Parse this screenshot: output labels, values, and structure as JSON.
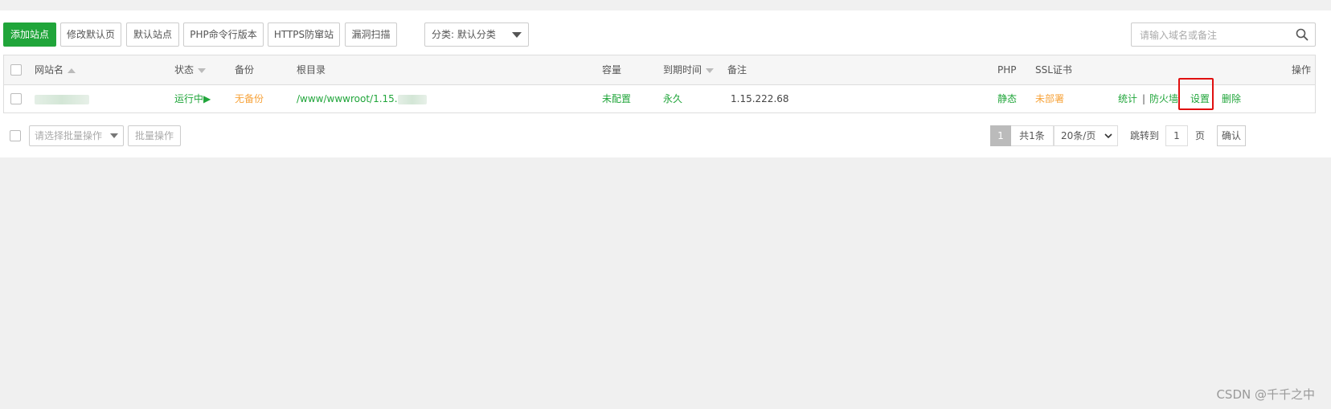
{
  "toolbar": {
    "add_site": "添加站点",
    "edit_default_page": "修改默认页",
    "default_site": "默认站点",
    "php_cli_version": "PHP命令行版本",
    "https_anti_leech": "HTTPS防窜站",
    "vuln_scan": "漏洞扫描",
    "category_select": "分类: 默认分类"
  },
  "search": {
    "placeholder": "请输入域名或备注"
  },
  "table": {
    "headers": {
      "site_name": "网站名",
      "status": "状态",
      "backup": "备份",
      "root_dir": "根目录",
      "capacity": "容量",
      "expire": "到期时间",
      "remark": "备注",
      "php": "PHP",
      "ssl": "SSL证书",
      "actions": "操作"
    },
    "rows": [
      {
        "status": "运行中▶",
        "backup": "无备份",
        "root_dir": "/www/wwwroot/1.15.",
        "capacity": "未配置",
        "expire": "永久",
        "remark": "1.15.222.68",
        "php": "静态",
        "ssl": "未部署",
        "actions": {
          "stats": "统计",
          "separator": "|",
          "firewall": "防火墙",
          "settings": "设置",
          "delete": "删除"
        }
      }
    ]
  },
  "footer": {
    "batch_select_placeholder": "请选择批量操作",
    "batch_button": "批量操作",
    "current_page": "1",
    "total": "共1条",
    "per_page": "20条/页",
    "jump_to": "跳转到",
    "jump_value": "1",
    "page_unit": "页",
    "confirm": "确认"
  },
  "watermark": "CSDN @千千之中",
  "colors": {
    "accent": "#20a53a",
    "warning": "#f7a33a",
    "highlight": "#e01010"
  }
}
